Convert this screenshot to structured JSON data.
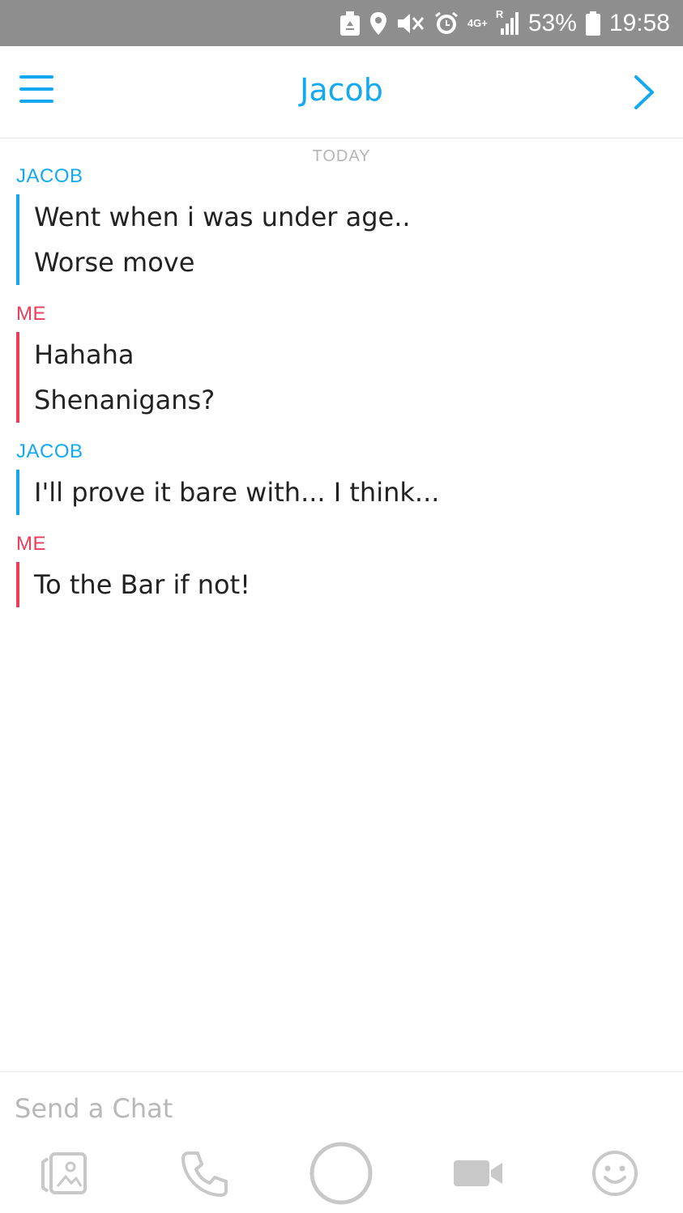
{
  "status_bar": {
    "network": "4G+",
    "roaming": "R",
    "battery": "53%",
    "time": "19:58"
  },
  "header": {
    "title": "Jacob"
  },
  "chat": {
    "date_separator": "TODAY",
    "groups": [
      {
        "sender": "JACOB",
        "messages": [
          "Went when i was under age..",
          "Worse move"
        ]
      },
      {
        "sender": "ME",
        "messages": [
          "Hahaha",
          "Shenanigans?"
        ]
      },
      {
        "sender": "JACOB",
        "messages": [
          "I'll prove it bare with... I think..."
        ]
      },
      {
        "sender": "ME",
        "messages": [
          "To the Bar if not!"
        ]
      }
    ]
  },
  "composer": {
    "placeholder": "Send a Chat"
  },
  "colors": {
    "accent": "#12a9f0",
    "me": "#ee3d58",
    "statusbar": "#8e8e8e"
  },
  "icons": {
    "toolbar": [
      "memories-icon",
      "phone-icon",
      "camera-shutter-icon",
      "video-icon",
      "smiley-icon"
    ]
  }
}
